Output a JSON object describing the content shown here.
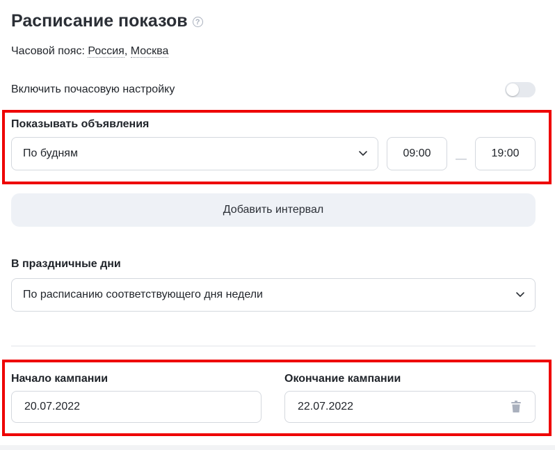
{
  "header": {
    "title": "Расписание показов",
    "help_icon": "?"
  },
  "timezone": {
    "label": "Часовой пояс: ",
    "country": "Россия",
    "separator": ", ",
    "city": "Москва"
  },
  "hourly": {
    "label": "Включить почасовую настройку",
    "enabled": false
  },
  "schedule": {
    "label": "Показывать объявления",
    "days_value": "По будням",
    "time_from": "09:00",
    "dash": "—",
    "time_to": "19:00",
    "add_interval_label": "Добавить интервал"
  },
  "holidays": {
    "label": "В праздничные дни",
    "value": "По расписанию соответствующего дня недели"
  },
  "campaign": {
    "start_label": "Начало кампании",
    "start_value": "20.07.2022",
    "end_label": "Окончание кампании",
    "end_value": "22.07.2022"
  },
  "colors": {
    "highlight": "#ee0000",
    "button_bg": "#eef1f6",
    "border": "#d4d8de"
  },
  "icons": [
    "help-icon",
    "chevron-down-icon",
    "trash-icon"
  ]
}
